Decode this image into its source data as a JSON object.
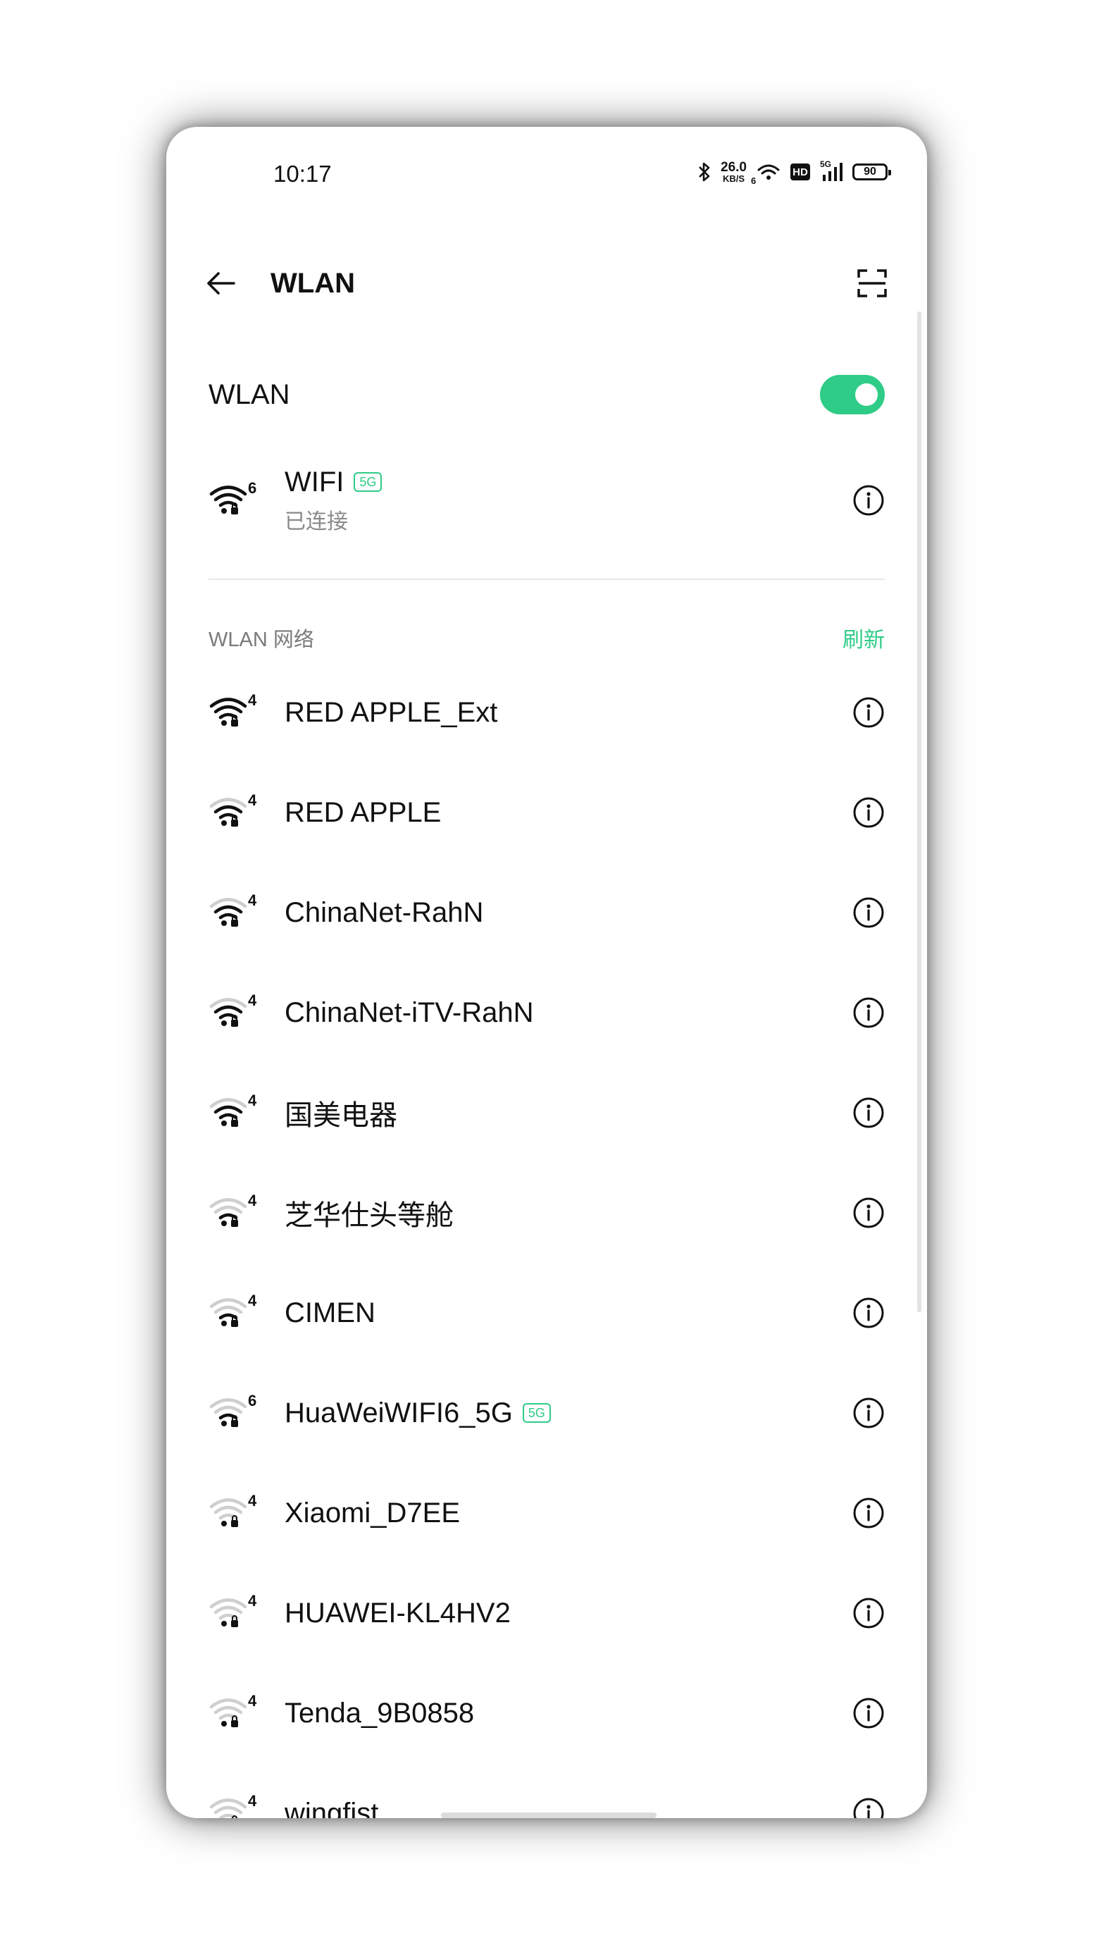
{
  "status": {
    "time": "10:17",
    "net_speed_value": "26.0",
    "net_speed_unit": "KB/S",
    "wifi_gen": "6",
    "hd": "HD",
    "mobile_gen": "5G",
    "battery": "90"
  },
  "header": {
    "title": "WLAN"
  },
  "wlan_toggle": {
    "label": "WLAN",
    "on": true
  },
  "connected": {
    "name": "WIFI",
    "badge": "5G",
    "status": "已连接",
    "gen": "6",
    "signal": 4
  },
  "section": {
    "title": "WLAN 网络",
    "refresh": "刷新"
  },
  "networks": [
    {
      "name": "RED APPLE_Ext",
      "gen": "4",
      "signal": 4,
      "badge": ""
    },
    {
      "name": "RED APPLE",
      "gen": "4",
      "signal": 3,
      "badge": ""
    },
    {
      "name": "ChinaNet-RahN",
      "gen": "4",
      "signal": 3,
      "badge": ""
    },
    {
      "name": "ChinaNet-iTV-RahN",
      "gen": "4",
      "signal": 3,
      "badge": ""
    },
    {
      "name": "国美电器",
      "gen": "4",
      "signal": 3,
      "badge": ""
    },
    {
      "name": "芝华仕头等舱",
      "gen": "4",
      "signal": 2,
      "badge": ""
    },
    {
      "name": "CIMEN",
      "gen": "4",
      "signal": 2,
      "badge": ""
    },
    {
      "name": "HuaWeiWIFI6_5G",
      "gen": "6",
      "signal": 2,
      "badge": "5G"
    },
    {
      "name": "Xiaomi_D7EE",
      "gen": "4",
      "signal": 1,
      "badge": ""
    },
    {
      "name": "HUAWEI-KL4HV2",
      "gen": "4",
      "signal": 1,
      "badge": ""
    },
    {
      "name": "Tenda_9B0858",
      "gen": "4",
      "signal": 1,
      "badge": ""
    },
    {
      "name": "wingfist",
      "gen": "4",
      "signal": 1,
      "badge": ""
    }
  ],
  "colors": {
    "accent": "#2ecc86",
    "text": "#111111",
    "secondary": "#8a8a8a",
    "divider": "#e9e9e9"
  }
}
